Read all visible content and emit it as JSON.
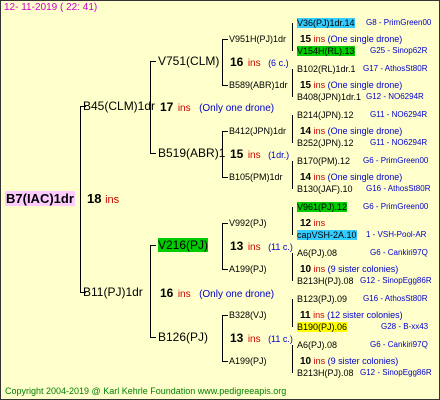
{
  "header": {
    "date": "12- 11-2019 ( 22: 41)"
  },
  "footer": {
    "copyright": "Copyright 2004-2019 @ Karl Kehrle Foundation   www.pedigreeapis.org"
  },
  "root": {
    "name": "B7(IAC)1dr",
    "num": "18",
    "ins": "ins"
  },
  "g1": [
    {
      "name": "B45(CLM)1dr",
      "num": "17",
      "ins": "ins",
      "note": "(Only one drone)"
    },
    {
      "name": "B11(PJ)1dr",
      "num": "16",
      "ins": "ins",
      "note": "(Only one drone)"
    }
  ],
  "g2": [
    {
      "name": "V751(CLM)",
      "num": "16",
      "ins": "ins",
      "note": "(6 c.)"
    },
    {
      "name": "B519(ABR)1",
      "num": "15",
      "ins": "ins",
      "note": "(1dr.)"
    },
    {
      "name": "V216(PJ)",
      "num": "13",
      "ins": "ins",
      "note": "(11 c.)"
    },
    {
      "name": "B126(PJ)",
      "num": "13",
      "ins": "ins",
      "note": "(11 c.)"
    }
  ],
  "g3": [
    {
      "name": "V951H(PJ)1dr",
      "num": "15",
      "ins": "ins",
      "note": "(One single drone)"
    },
    {
      "name": "B589(ABR)1dr",
      "num": "15",
      "ins": "ins",
      "note": "(One single drone)"
    },
    {
      "name": "B412(JPN)1dr",
      "num": "14",
      "ins": "ins",
      "note": "(One single drone)"
    },
    {
      "name": "B105(PM)1dr",
      "num": "14",
      "ins": "ins",
      "note": "(One single drone)"
    },
    {
      "name": "V992(PJ)",
      "num": "12",
      "ins": "ins",
      "note": ""
    },
    {
      "name": "A199(PJ)",
      "num": "10",
      "ins": "ins",
      "note": "(9 sister colonies)"
    },
    {
      "name": "B328(VJ)",
      "num": "11",
      "ins": "ins",
      "note": "(12 sister colonies)"
    },
    {
      "name": "A199(PJ)",
      "num": "10",
      "ins": "ins",
      "note": "(9 sister colonies)"
    }
  ],
  "g4": [
    {
      "name": "V36(PJ)1dr.14",
      "src": "G8 - PrimGreen00"
    },
    {
      "name": "V154H(RL).13",
      "src": "G25 - Sinop62R"
    },
    {
      "name": "B102(RL)1dr.1",
      "src": "G17 - AthosSt80R"
    },
    {
      "name": "B408(JPN)1dr.1",
      "src": "G12 - NO6294R"
    },
    {
      "name": "B214(JPN).12",
      "src": "G11 - NO6294R"
    },
    {
      "name": "B252(JPN).12",
      "src": "G11 - NO6294R"
    },
    {
      "name": "B170(PM).12",
      "src": "G6 - PrimGreen00"
    },
    {
      "name": "B130(JAF).10",
      "src": "G16 - AthosSt80R"
    },
    {
      "name": "V961(PJ).12",
      "src": "G6 - PrimGreen00"
    },
    {
      "name": "capVSH-2A.10",
      "src": "1 - VSH-Pool-AR"
    },
    {
      "name": "A6(PJ).08",
      "src": "G6 - Cankiri97Q"
    },
    {
      "name": "B213H(PJ).08",
      "src": "G12 - SinopEgg86R"
    },
    {
      "name": "B123(PJ).09",
      "src": "G16 - AthosSt80R"
    },
    {
      "name": "B190(PJ).06",
      "src": "G28 - B-xx43"
    },
    {
      "name": "A6(PJ).08",
      "src": "G6 - Cankiri97Q"
    },
    {
      "name": "B213H(PJ).08",
      "src": "G12 - SinopEgg86R"
    }
  ]
}
